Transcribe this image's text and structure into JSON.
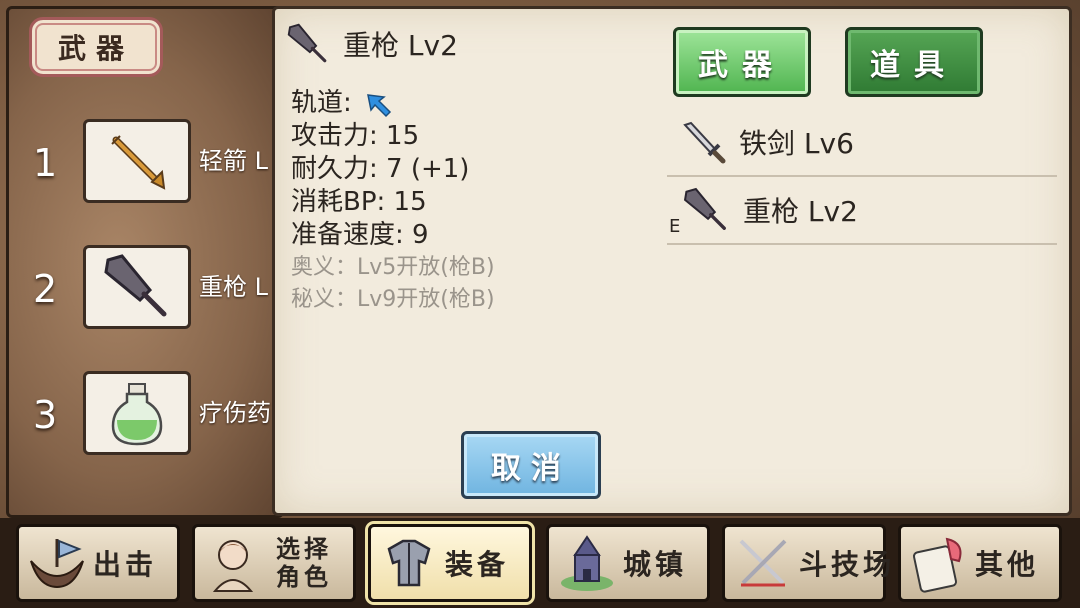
{
  "panel_title": "武器",
  "slots": [
    {
      "num": "1",
      "label": "轻箭 L",
      "icon": "arrow-icon"
    },
    {
      "num": "2",
      "label": "重枪 L",
      "icon": "heavy-spear-icon"
    },
    {
      "num": "3",
      "label": "疗伤药",
      "icon": "potion-icon"
    }
  ],
  "detail": {
    "name": "重枪 Lv2",
    "track_label": "轨道:",
    "attack": "攻击力: 15",
    "durability": "耐久力: 7 (+1)",
    "bp_cost": "消耗BP: 15",
    "prep_speed": "准备速度: 9",
    "secret1": "奥义：Lv5开放(枪B)",
    "secret2": "秘义：Lv9开放(枪B)"
  },
  "tabs": {
    "weapon": "武器",
    "item": "道具"
  },
  "inventory": [
    {
      "name": "铁剑 Lv6",
      "equipped": "",
      "icon": "iron-sword-icon"
    },
    {
      "name": "重枪 Lv2",
      "equipped": "E",
      "icon": "heavy-spear-icon"
    }
  ],
  "cancel_label": "取消",
  "nav": {
    "sortie": "出击",
    "select_char": "选择角色",
    "equip": "装备",
    "town": "城镇",
    "arena": "斗技场",
    "other": "其他"
  },
  "colors": {
    "tab_active": "#4fb44f",
    "tab_inactive": "#2f7a33",
    "cancel": "#6fb4e0",
    "paper": "#f2ebdd"
  }
}
